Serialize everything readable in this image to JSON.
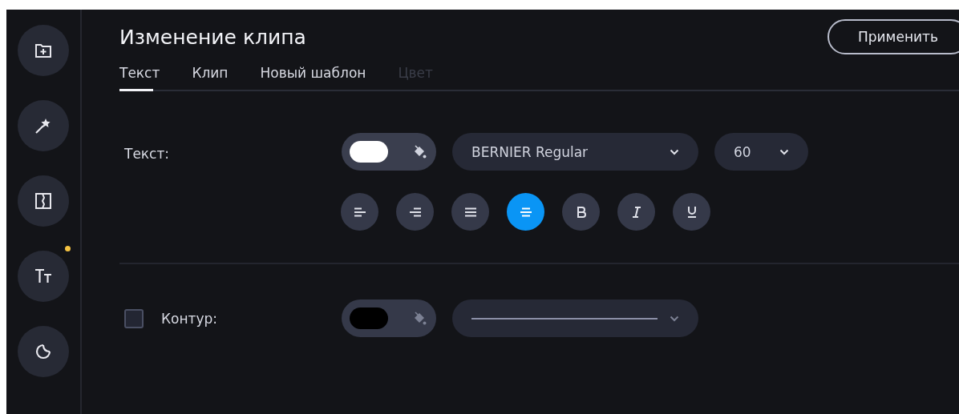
{
  "sidebar": {
    "items": [
      {
        "kind": "add-folder",
        "selected": false,
        "dot": false
      },
      {
        "kind": "wand",
        "selected": false,
        "dot": false
      },
      {
        "kind": "transition",
        "selected": false,
        "dot": false
      },
      {
        "kind": "text",
        "selected": false,
        "dot": true
      },
      {
        "kind": "sticker",
        "selected": false,
        "dot": false
      }
    ]
  },
  "header": {
    "title": "Изменение клипа",
    "apply_button": "Применить"
  },
  "tabs": [
    {
      "label": "Текст",
      "selected": true,
      "disabled": false
    },
    {
      "label": "Клип",
      "selected": false,
      "disabled": false
    },
    {
      "label": "Новый шаблон",
      "selected": false,
      "disabled": false
    },
    {
      "label": "Цвет",
      "selected": false,
      "disabled": true
    }
  ],
  "text_settings": {
    "label": "Текст:",
    "color": "#ffffff",
    "font": "BERNIER Regular",
    "size": "60",
    "format_buttons": [
      {
        "kind": "align-left",
        "selected": false
      },
      {
        "kind": "align-right",
        "selected": false
      },
      {
        "kind": "justify",
        "selected": false
      },
      {
        "kind": "align-center",
        "selected": true
      },
      {
        "kind": "bold",
        "selected": false
      },
      {
        "kind": "italic",
        "selected": false
      },
      {
        "kind": "underline",
        "selected": false
      }
    ]
  },
  "outline": {
    "label": "Контур:",
    "checked": false,
    "color": "#000000"
  }
}
